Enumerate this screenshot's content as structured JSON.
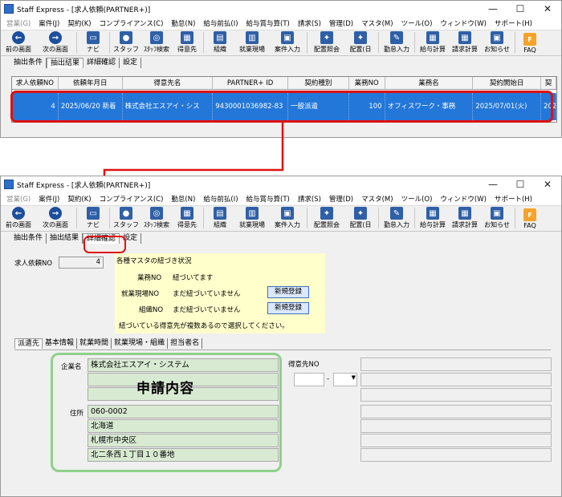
{
  "window_title": "Staff Express - [求人依頼(PARTNER+)]",
  "window_controls": [
    "—",
    "☐",
    "✕"
  ],
  "menus": [
    "営業(G)",
    "案件(J)",
    "契約(K)",
    "コンプライアンス(C)",
    "勤怠(N)",
    "給与前払(I)",
    "給与賞与算(T)",
    "請求(S)",
    "管理(D)",
    "マスタ(M)",
    "ツール(O)",
    "ウィンドウ(W)",
    "サポート(H)"
  ],
  "toolbar": {
    "prev": "前の画面",
    "next": "次の画面",
    "navi": "ナビ",
    "staff": "スタッフ",
    "staff_search": "ｽﾀｯﾌ検索",
    "client": "得意先",
    "org": "組織",
    "site": "就業現場",
    "job_entry": "案件入力",
    "dispatch_inquiry": "配置照会",
    "dispatch_day": "配置(日",
    "attendance": "勤怠入力",
    "salary": "給与計算",
    "billing": "請求計算",
    "notice": "お知らせ",
    "faq": "FAQ"
  },
  "tabs": [
    "抽出条件",
    "抽出結果",
    "詳細確認",
    "設定"
  ],
  "grid": {
    "headers": [
      "求人依頼NO",
      "依頼年月日",
      "得意先名",
      "PARTNER+ ID",
      "契約種別",
      "業務NO",
      "業務名",
      "契約開始日",
      "契"
    ],
    "row": [
      "4",
      "2025/06/20 新着",
      "株式会社エスアイ・シス",
      "9430001036982-83",
      "一般派遣",
      "100",
      "オフィスワーク・事務",
      "2025/07/01(火)",
      "202"
    ]
  },
  "detail": {
    "request_no_label": "求人依頼NO",
    "request_no_value": "4",
    "master_status_title": "各種マスタの紐づき状況",
    "business_no_label": "業務NO",
    "business_no_status": "紐づいてます",
    "site_no_label": "就業現場NO",
    "site_no_status": "まだ紐づいていません",
    "org_no_label": "組織NO",
    "org_no_status": "まだ紐づいていません",
    "register_button": "新規登録",
    "multiple_clients_note": "紐づいている得意先が複数あるので選択してください。"
  },
  "subtabs": [
    "派遣先",
    "基本情報",
    "就業時間",
    "就業現場・組織",
    "担当者名"
  ],
  "application": {
    "company_label": "企業名",
    "company_name": "株式会社エスアイ・システム",
    "address_label": "住所",
    "postal": "060-0002",
    "pref": "北海道",
    "city": "札幌市中央区",
    "street": "北二条西１丁目１０番地",
    "overlay_title": "申請内容",
    "client_no_label": "得意先NO",
    "dash": "-"
  },
  "colors": {
    "highlight": "#e01010",
    "selection": "#2377d9",
    "green": "#8fd18a",
    "yellow": "#ffffcc"
  }
}
